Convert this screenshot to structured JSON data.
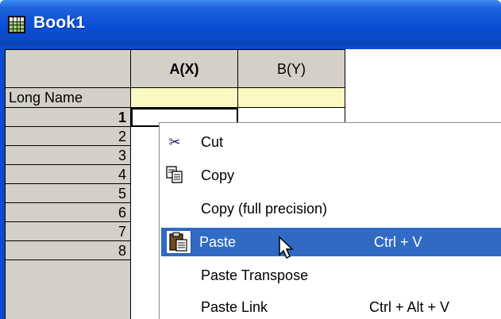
{
  "window": {
    "title": "Book1"
  },
  "columns": [
    {
      "label": "A(X)"
    },
    {
      "label": "B(Y)"
    }
  ],
  "long_name_label": "Long Name",
  "rows": [
    "1",
    "2",
    "3",
    "4",
    "5",
    "6",
    "7",
    "8"
  ],
  "context_menu": {
    "items": [
      {
        "label": "Cut",
        "shortcut": "",
        "icon": "scissors-icon"
      },
      {
        "label": "Copy",
        "shortcut": "",
        "icon": "copy-icon"
      },
      {
        "label": "Copy (full precision)",
        "shortcut": ""
      },
      {
        "label": "Paste",
        "shortcut": "Ctrl + V",
        "icon": "paste-icon",
        "highlighted": true
      },
      {
        "label": "Paste Transpose",
        "shortcut": ""
      },
      {
        "label": "Paste Link",
        "shortcut": "Ctrl + Alt + V"
      }
    ]
  },
  "colors": {
    "title_bar": "#0a4fd6",
    "header_gray": "#d4d0c8",
    "long_name_yellow": "#fbf8c4",
    "menu_highlight": "#316ac5"
  }
}
